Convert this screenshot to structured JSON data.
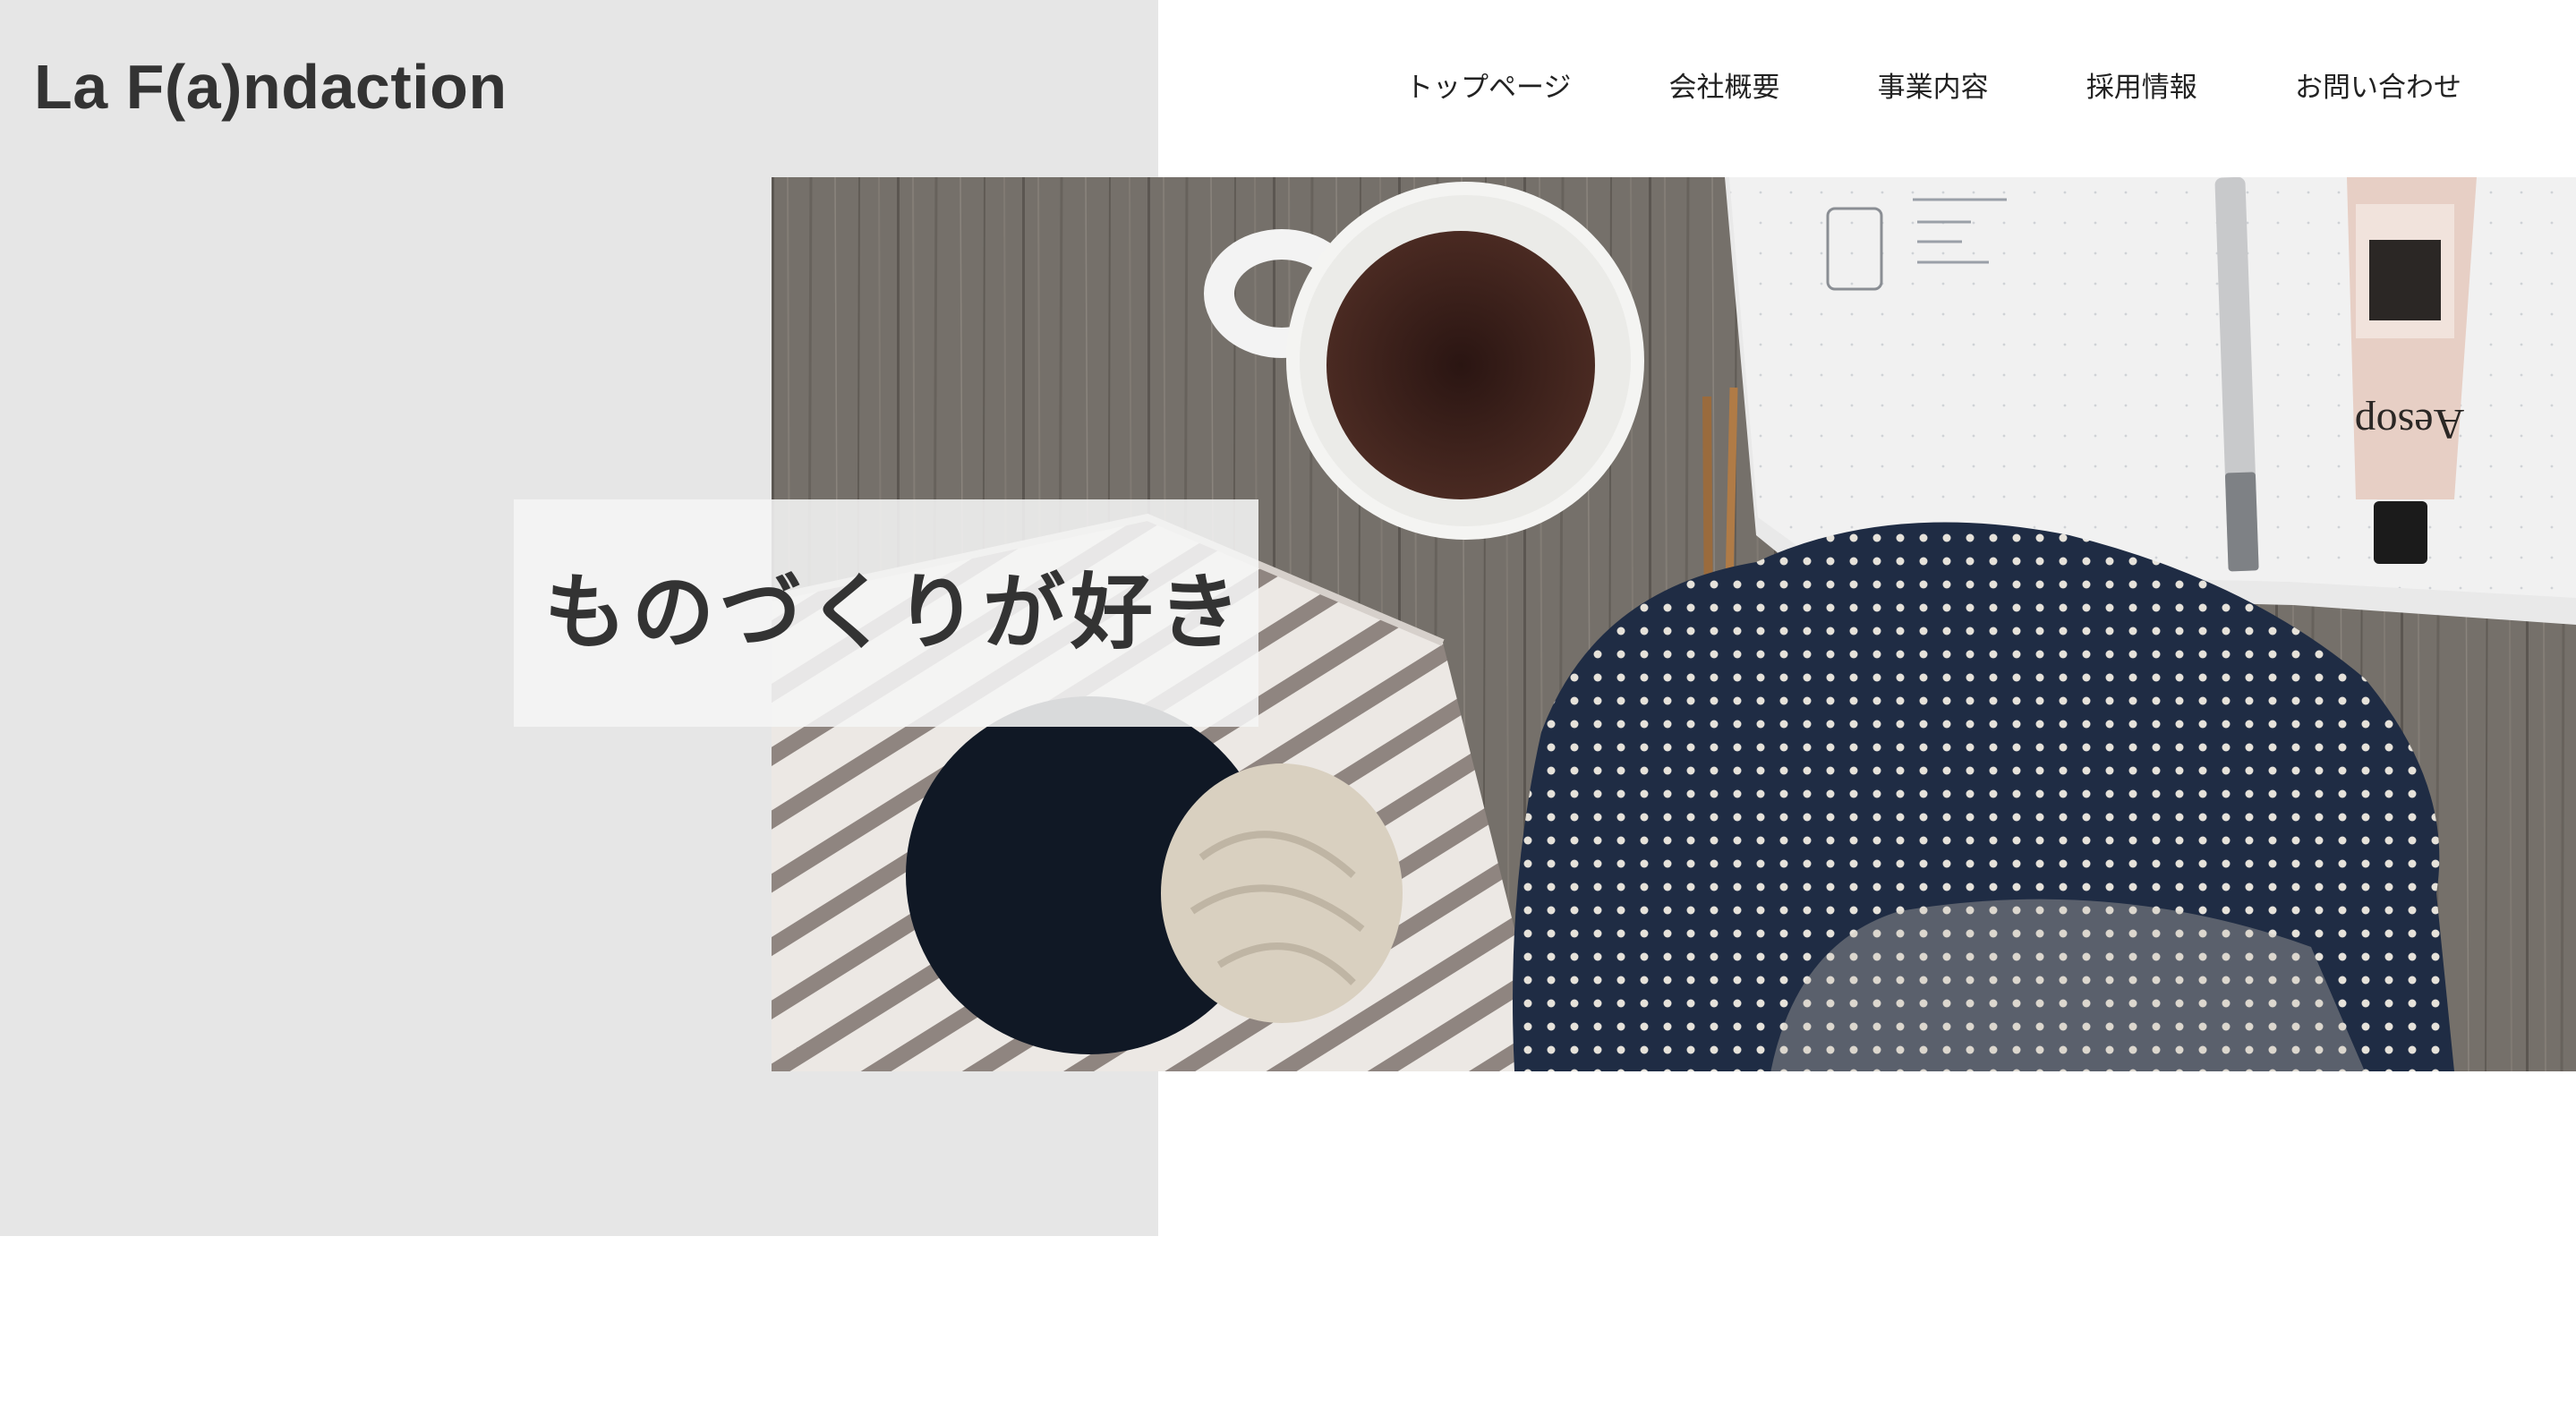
{
  "header": {
    "logo": "La F(a)ndaction"
  },
  "nav": {
    "items": [
      {
        "label": "トップページ"
      },
      {
        "label": "会社概要"
      },
      {
        "label": "事業内容"
      },
      {
        "label": "採用情報"
      },
      {
        "label": "お問い合わせ"
      }
    ]
  },
  "hero": {
    "headline": "ものづくりが好き",
    "photo_subject": "knitting-flatlay-photo",
    "tube_label": "Aesop"
  },
  "colors": {
    "panel_gray": "#e6e6e6",
    "text_dark": "#333333",
    "background": "#ffffff"
  }
}
